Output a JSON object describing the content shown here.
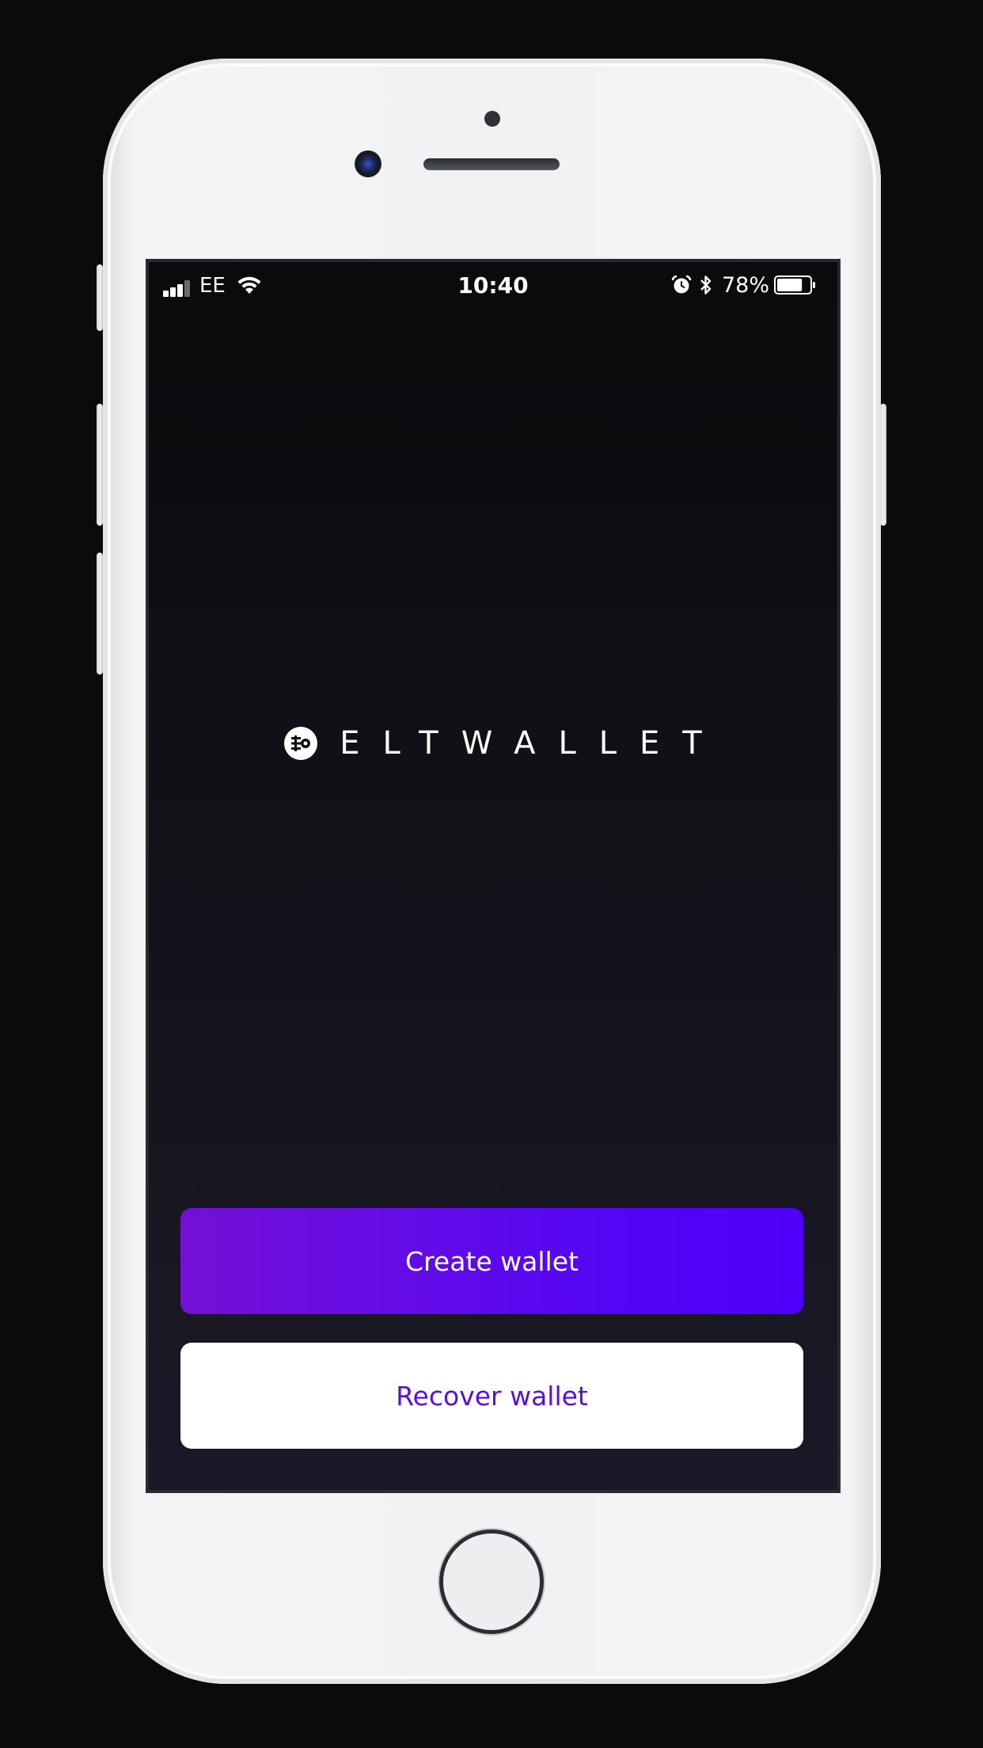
{
  "status_bar": {
    "carrier": "EE",
    "time": "10:40",
    "battery_percent": "78%",
    "battery_level": 0.78,
    "icons": [
      "signal-icon",
      "wifi-icon",
      "alarm-icon",
      "bluetooth-icon",
      "battery-icon"
    ]
  },
  "brand": {
    "name": "ELTWALLET",
    "logo_icon": "eltwallet-logo-icon"
  },
  "actions": {
    "create_label": "Create wallet",
    "recover_label": "Recover wallet"
  },
  "colors": {
    "background_top": "#0b0b0d",
    "background_bottom": "#1b1928",
    "create_gradient_start": "#7410d6",
    "create_gradient_end": "#4f00fa",
    "recover_background": "#ffffff",
    "recover_text": "#5a0fd8"
  }
}
